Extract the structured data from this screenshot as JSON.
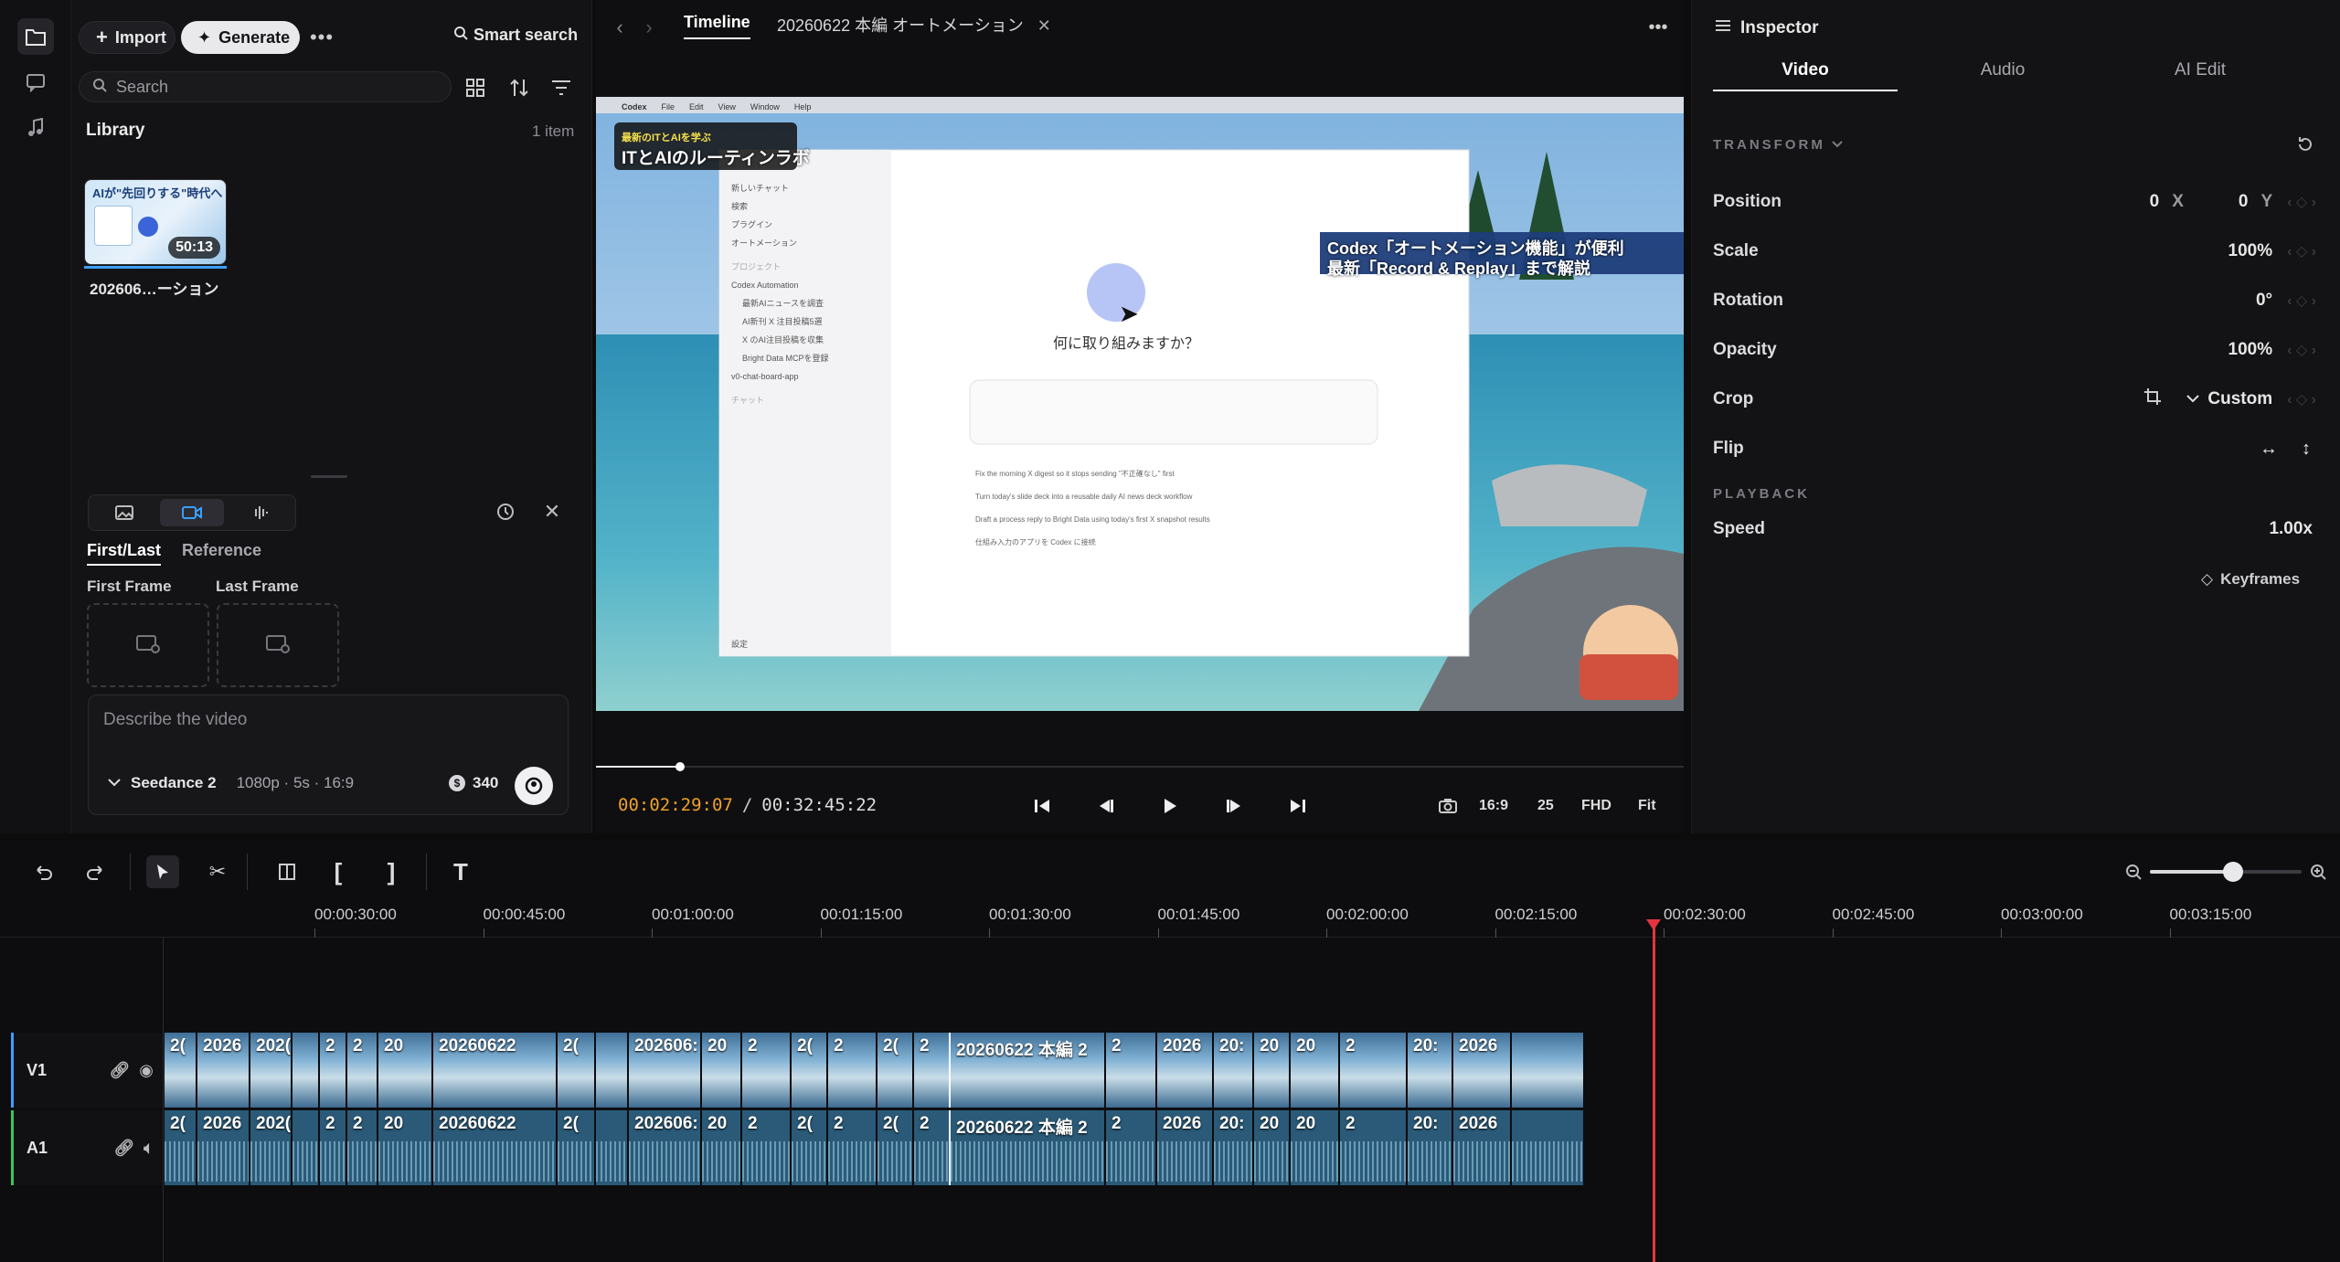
{
  "sidebar": {
    "icons": [
      "folder-icon",
      "chat-icon",
      "music-icon"
    ]
  },
  "library": {
    "import_label": "Import",
    "generate_label": "Generate",
    "smart_search_label": "Smart search",
    "search_placeholder": "Search",
    "title": "Library",
    "count": "1 item",
    "media": [
      {
        "name": "202606…ーション",
        "duration": "50:13",
        "thumb_title": "AIが\"先回りする\"時代へ"
      }
    ]
  },
  "generate_panel": {
    "tabs": [
      "First/Last",
      "Reference"
    ],
    "active_tab": "First/Last",
    "first_frame_label": "First Frame",
    "last_frame_label": "Last Frame",
    "prompt_placeholder": "Describe the video",
    "model": "Seedance 2",
    "settings": "1080p · 5s · 16:9",
    "credits": "340"
  },
  "viewer": {
    "tab_timeline": "Timeline",
    "tab_project": "20260622 本編 オートメーション",
    "current_time": "00:02:29:07",
    "separator": "/",
    "total_time": "00:32:45:22",
    "aspect": "16:9",
    "fps": "25",
    "quality": "FHD",
    "fit": "Fit",
    "progress_fraction": 0.077,
    "overlay": {
      "top_left_badge": "最新のITとAIを学ぶ",
      "top_left_title": "ITとAIのルーティンラボ",
      "caption_line1": "Codex「オートメーション機能」が便利",
      "caption_line2": "最新「Record & Replay」まで解説",
      "app_question": "何に取り組みますか？",
      "app_menu": [
        "Codex",
        "File",
        "Edit",
        "View",
        "Window",
        "Help"
      ],
      "sidebar_items": [
        "新しいチャット",
        "検索",
        "プラグイン",
        "オートメーション"
      ],
      "sidebar_section": "プロジェクト",
      "project_name": "Codex Automation",
      "project_items": [
        "最新AIニュースを調査",
        "AI新刊 X 注目投稿5選",
        "X のAI注目投稿を収集",
        "Bright Data MCPを登録"
      ],
      "other_project": "v0-chat-board-app",
      "chat_label": "チャット",
      "settings_label": "設定",
      "suggestions": [
        "Fix the morning X digest so it stops sending \"不正確なし\" first",
        "Turn today's slide deck into a reusable daily AI news deck workflow",
        "Draft a process reply to Bright Data using today's first X snapshot results",
        "仕組み入力のアプリを Codex に接続"
      ]
    }
  },
  "inspector": {
    "title": "Inspector",
    "tabs": [
      "Video",
      "Audio",
      "AI Edit"
    ],
    "active_tab": "Video",
    "transform_header": "TRANSFORM",
    "position_label": "Position",
    "position_x": "0",
    "position_x_axis": "X",
    "position_y": "0",
    "position_y_axis": "Y",
    "scale_label": "Scale",
    "scale": "100%",
    "rotation_label": "Rotation",
    "rotation": "0°",
    "opacity_label": "Opacity",
    "opacity": "100%",
    "crop_label": "Crop",
    "crop_value": "Custom",
    "flip_label": "Flip",
    "playback_header": "PLAYBACK",
    "speed_label": "Speed",
    "speed": "1.00x",
    "keyframes_label": "Keyframes"
  },
  "timeline": {
    "ruler_labels": [
      "00:00:30:00",
      "00:00:45:00",
      "00:01:00:00",
      "00:01:15:00",
      "00:01:30:00",
      "00:01:45:00",
      "00:02:00:00",
      "00:02:15:00",
      "00:02:30:00",
      "00:02:45:00",
      "00:03:00:00",
      "00:03:15:00"
    ],
    "zoom_fraction": 0.55,
    "tracks": [
      {
        "id": "V1",
        "type": "video"
      },
      {
        "id": "A1",
        "type": "audio"
      }
    ],
    "clip_titles": [
      "2(",
      "2026",
      "202(",
      "",
      "2",
      "2",
      "20",
      "20260622",
      "2(",
      "",
      "202606:",
      "20",
      "2",
      "2(",
      "2",
      "2(",
      "2",
      "20260622 本編 2",
      "2",
      "2026",
      "20:",
      "20",
      "20",
      "2",
      "20:",
      "2026",
      ""
    ]
  }
}
